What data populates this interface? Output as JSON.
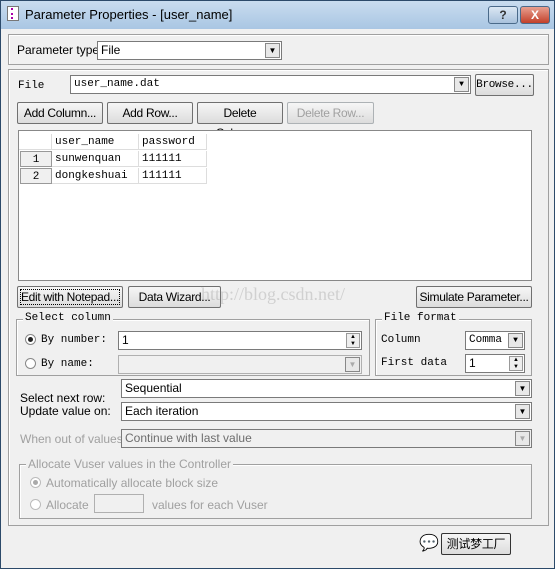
{
  "window": {
    "title": "Parameter Properties - [user_name]",
    "help_label": "?",
    "close_label": "X"
  },
  "param_type": {
    "label": "Parameter type:",
    "value": "File"
  },
  "file": {
    "label": "File",
    "value": "user_name.dat",
    "browse": "Browse..."
  },
  "toolbar": {
    "add_column": "Add Column...",
    "add_row": "Add Row...",
    "delete_column": "Delete Column...",
    "delete_row": "Delete Row..."
  },
  "table": {
    "columns": [
      "user_name",
      "password"
    ],
    "rows": [
      {
        "num": "1",
        "cells": [
          "sunwenquan",
          "111111"
        ]
      },
      {
        "num": "2",
        "cells": [
          "dongkeshuai",
          "111111"
        ]
      }
    ]
  },
  "actions": {
    "edit_notepad": "Edit with Notepad...",
    "data_wizard": "Data Wizard...",
    "simulate": "Simulate Parameter..."
  },
  "watermark": "http://blog.csdn.net/",
  "select_column": {
    "title": "Select column",
    "by_number_label": "By number:",
    "by_number_value": "1",
    "by_name_label": "By name:",
    "selected": "by_number"
  },
  "file_format": {
    "title": "File format",
    "column_label": "Column",
    "column_value": "Comma",
    "first_data_label": "First data",
    "first_data_value": "1"
  },
  "select_next_row": {
    "label": "Select next row:",
    "value": "Sequential"
  },
  "update_value": {
    "label": "Update value on:",
    "value": "Each iteration"
  },
  "out_of_values": {
    "label": "When out of values:",
    "value": "Continue with last value"
  },
  "allocate": {
    "title": "Allocate Vuser values in the Controller",
    "auto_label": "Automatically allocate block size",
    "allocate_label": "Allocate",
    "allocate_suffix": "values for each Vuser"
  },
  "footer": {
    "button_label": "测试梦工厂"
  }
}
